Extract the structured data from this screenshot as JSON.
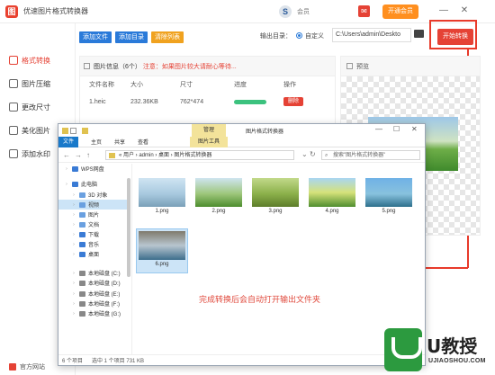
{
  "app": {
    "title": "优速图片格式转换器",
    "member_label": "会员",
    "open_member": "开通会员",
    "minimize": "—",
    "close": "✕"
  },
  "sidebar": {
    "items": [
      {
        "label": "格式转换",
        "active": true
      },
      {
        "label": "图片压缩"
      },
      {
        "label": "更改尺寸"
      },
      {
        "label": "美化图片"
      },
      {
        "label": "添加水印"
      }
    ],
    "footer": "官方网站"
  },
  "toolbar": {
    "add_file": "添加文件",
    "add_dir": "添加目录",
    "clear_list": "清除列表",
    "output_dir_label": "输出目录：",
    "custom_label": "自定义",
    "output_path": "C:\\Users\\admin\\Deskto",
    "start_label": "开始转换"
  },
  "file_list": {
    "header": "图片信息（6个）",
    "note": "注意：如果图片较大请耐心等待...",
    "columns": [
      "文件名称",
      "大小",
      "尺寸",
      "进度",
      "操作"
    ],
    "rows": [
      {
        "name": "1.heic",
        "size": "232.36KB",
        "dim": "762*474",
        "progress": 1.0,
        "action": "删除"
      }
    ]
  },
  "preview": {
    "title": "预览"
  },
  "explorer": {
    "manage_tab": "管理",
    "window_title": "图片格式转换器",
    "ribbon_tabs": [
      "文件",
      "主页",
      "共享",
      "查看"
    ],
    "picture_tools": "图片工具",
    "address": "« 用户 › admin › 桌面 › 图片格式转换器",
    "search_placeholder": "搜索\"图片格式转换器\"",
    "tree": [
      {
        "label": "WPS网盘",
        "color": "#3a7bd5"
      },
      {
        "label": "此电脑",
        "color": "#3a7bd5"
      },
      {
        "label": "3D 对象",
        "color": "#6aa0e0"
      },
      {
        "label": "视频",
        "color": "#6aa0e0",
        "selected": true
      },
      {
        "label": "图片",
        "color": "#6aa0e0"
      },
      {
        "label": "文档",
        "color": "#6aa0e0"
      },
      {
        "label": "下载",
        "color": "#3a7bd5"
      },
      {
        "label": "音乐",
        "color": "#3a7bd5"
      },
      {
        "label": "桌面",
        "color": "#3a7bd5"
      },
      {
        "label": "本地磁盘 (C:)",
        "color": "#888888"
      },
      {
        "label": "本地磁盘 (D:)",
        "color": "#888888"
      },
      {
        "label": "本地磁盘 (E:)",
        "color": "#888888"
      },
      {
        "label": "本地磁盘 (F:)",
        "color": "#888888"
      },
      {
        "label": "本地磁盘 (G:)",
        "color": "#888888"
      }
    ],
    "files": [
      {
        "name": "1.png",
        "gradient": "linear-gradient(#cfe4f2, #a8c9df 55%, #7aa0b8)"
      },
      {
        "name": "2.png",
        "gradient": "linear-gradient(#cfe5f0, #9dc67a 55%, #4d8d2e)"
      },
      {
        "name": "3.png",
        "gradient": "linear-gradient(#c2d98a, #8bb04a 55%, #5d7d2a)"
      },
      {
        "name": "4.png",
        "gradient": "linear-gradient(#a9d6f2, #d6e27a 50%, #4f8e2f)"
      },
      {
        "name": "5.png",
        "gradient": "linear-gradient(#6fb1e6, #88c2de 55%, #2d6f8c)"
      },
      {
        "name": "6.png",
        "gradient": "linear-gradient(#7f7a6c, #b8c5cf 50%, #3d6e8c)",
        "selected": true
      }
    ],
    "message": "完成转换后会自动打开输出文件夹",
    "status": {
      "count": "6 个项目",
      "selected": "选中 1 个项目  731 KB"
    }
  },
  "watermark": {
    "brand": "U教授",
    "url": "UJIAOSHOU.COM"
  },
  "colors": {
    "accent": "#e54235",
    "add_file": "#2a7ad9",
    "add_dir": "#2a7ad9",
    "clear_list": "#f0a21f",
    "highlight": "#e83a2a"
  }
}
